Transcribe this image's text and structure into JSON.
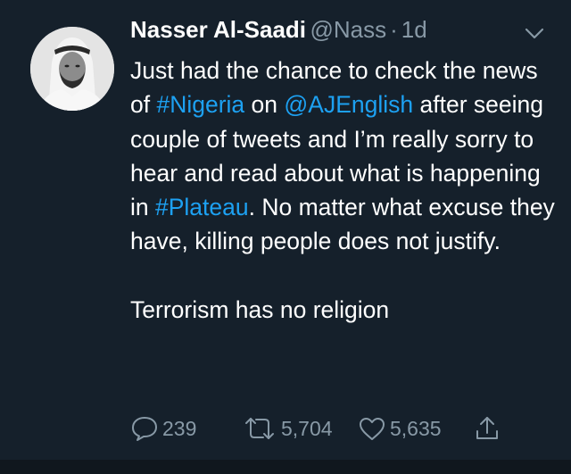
{
  "tweet": {
    "name": "Nasser Al-Saadi",
    "handle": "@Nass",
    "separator": "·",
    "time": "1d",
    "body": {
      "t1": "Just had the chance to check the news of ",
      "link1": "#Nigeria",
      "t2": " on ",
      "link2": "@AJEnglish",
      "t3": " after seeing couple of tweets and I’m really sorry to hear and read about what is happening in ",
      "link3": "#Plateau",
      "t4": ". No matter what excuse they have, killing people does not justify.",
      "p2": "Terrorism has no religion"
    },
    "actions": {
      "replies": "239",
      "retweets": "5,704",
      "likes": "5,635"
    }
  },
  "colors": {
    "background": "#15202b",
    "text": "#ffffff",
    "secondary": "#8899a6",
    "link": "#1da1f2"
  },
  "icons": {
    "reply": "speech-bubble-icon",
    "retweet": "retweet-arrows-icon",
    "like": "heart-icon",
    "share": "share-upload-icon",
    "menu": "chevron-down-icon"
  }
}
